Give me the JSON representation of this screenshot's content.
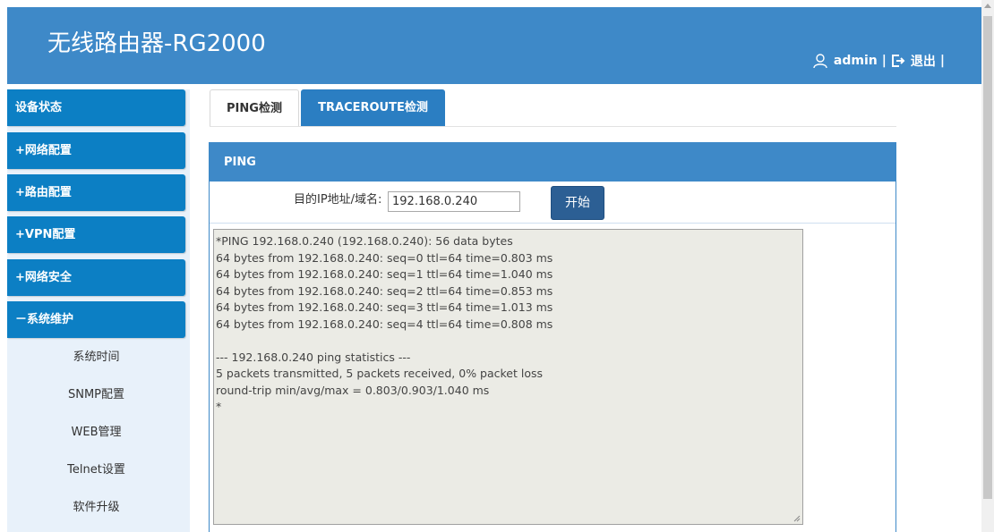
{
  "header": {
    "title": "无线路由器-RG2000",
    "user": "admin",
    "separator": "|",
    "logout_label": "退出",
    "trailing_separator": "|"
  },
  "sidebar": {
    "items": [
      {
        "label": "设备状态"
      },
      {
        "label": "+网络配置"
      },
      {
        "label": "+路由配置"
      },
      {
        "label": "+VPN配置"
      },
      {
        "label": "+网络安全"
      },
      {
        "label": "－系统维护"
      }
    ],
    "subitems": [
      {
        "label": "系统时间"
      },
      {
        "label": "SNMP配置"
      },
      {
        "label": "WEB管理"
      },
      {
        "label": "Telnet设置"
      },
      {
        "label": "软件升级"
      }
    ]
  },
  "tabs": [
    {
      "label": "PING检测",
      "active": true
    },
    {
      "label": "TRACEROUTE检测",
      "active": false
    }
  ],
  "panel": {
    "title": "PING",
    "ip_label": "目的IP地址/域名:",
    "ip_value": "192.168.0.240",
    "start_label": "开始",
    "output_lines": [
      "*PING 192.168.0.240 (192.168.0.240): 56 data bytes",
      "64 bytes from 192.168.0.240: seq=0 ttl=64 time=0.803 ms",
      "64 bytes from 192.168.0.240: seq=1 ttl=64 time=1.040 ms",
      "64 bytes from 192.168.0.240: seq=2 ttl=64 time=0.853 ms",
      "64 bytes from 192.168.0.240: seq=3 ttl=64 time=1.013 ms",
      "64 bytes from 192.168.0.240: seq=4 ttl=64 time=0.808 ms",
      "",
      "--- 192.168.0.240 ping statistics ---",
      "5 packets transmitted, 5 packets received, 0% packet loss",
      "round-trip min/avg/max = 0.803/0.903/1.040 ms",
      "*"
    ]
  },
  "colors": {
    "header_bg": "#3e89c8",
    "menu_bg": "#0c7fc4",
    "tab_active_bg": "#2b7ec2",
    "button_bg": "#2c5f94",
    "sidebar_bg": "#e8f1fa",
    "output_bg": "#ebebe5"
  }
}
